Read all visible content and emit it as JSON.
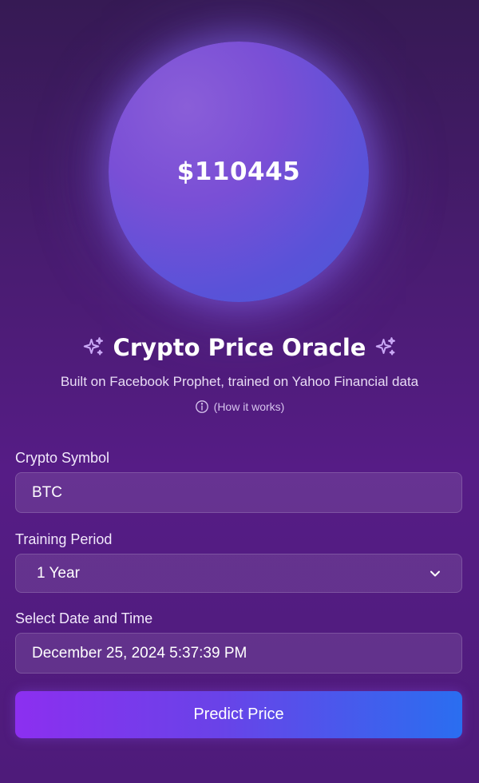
{
  "orb": {
    "price": "$110445"
  },
  "header": {
    "title": "Crypto Price Oracle",
    "subtitle": "Built on Facebook Prophet, trained on Yahoo Financial data",
    "how_it_works": "(How it works)"
  },
  "form": {
    "symbol_label": "Crypto Symbol",
    "symbol_value": "BTC",
    "period_label": "Training Period",
    "period_value": "1 Year",
    "datetime_label": "Select Date and Time",
    "datetime_value": "December 25, 2024 5:37:39 PM",
    "predict_label": "Predict Price"
  },
  "colors": {
    "accent_purple": "#8c2ff0",
    "accent_blue": "#2a6ef0",
    "sparkle": "#c9a8f5"
  },
  "icons": [
    "sparkle-icon",
    "info-icon",
    "chevron-down-icon"
  ]
}
